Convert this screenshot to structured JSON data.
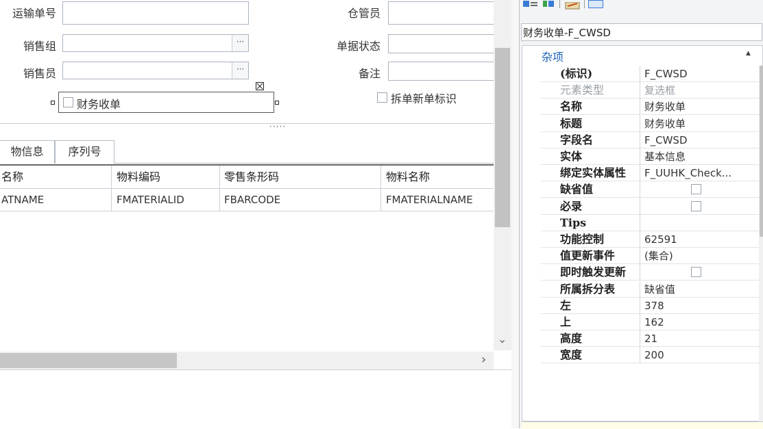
{
  "form": {
    "fields_left": [
      {
        "label": "运输单号",
        "has_ellipsis": false
      },
      {
        "label": "销售组",
        "has_ellipsis": true
      },
      {
        "label": "销售员",
        "has_ellipsis": true
      }
    ],
    "fields_right": [
      {
        "label": "仓管员"
      },
      {
        "label": "单据状态"
      },
      {
        "label": "备注"
      }
    ],
    "ellipsis_glyph": "···",
    "selected_checkbox_label": "财务收单",
    "split_checkbox_label": "拆单新单标识",
    "splitter_dots": "·····"
  },
  "tabs": [
    {
      "label": "物信息"
    },
    {
      "label": "序列号"
    }
  ],
  "grid": {
    "headers": [
      "名称",
      "物料编码",
      "零售条形码",
      "物料名称"
    ],
    "row": [
      "ATNAME",
      "FMATERIALID",
      "FBARCODE",
      "FMATERIALNAME"
    ]
  },
  "scroll": {
    "down_arrow": "⌄",
    "right_arrow": "›"
  },
  "property_panel": {
    "object_selector": "财务收单-F_CWSD",
    "category": "杂项",
    "collapse_glyph": "▲",
    "rows": [
      {
        "name": "(标识)",
        "value": "F_CWSD",
        "type": "text"
      },
      {
        "name": "元素类型",
        "value": "复选框",
        "type": "text",
        "dim": true
      },
      {
        "name": "名称",
        "value": "财务收单",
        "type": "text"
      },
      {
        "name": "标题",
        "value": "财务收单",
        "type": "text"
      },
      {
        "name": "字段名",
        "value": "F_CWSD",
        "type": "text"
      },
      {
        "name": "实体",
        "value": "基本信息",
        "type": "text"
      },
      {
        "name": "绑定实体属性",
        "value": "F_UUHK_Check...",
        "type": "text"
      },
      {
        "name": "缺省值",
        "value": "",
        "type": "checkbox"
      },
      {
        "name": "必录",
        "value": "",
        "type": "checkbox"
      },
      {
        "name": "Tips",
        "value": "",
        "type": "text"
      },
      {
        "name": "功能控制",
        "value": "62591",
        "type": "text"
      },
      {
        "name": "值更新事件",
        "value": "(集合)",
        "type": "text"
      },
      {
        "name": "即时触发更新",
        "value": "",
        "type": "checkbox"
      },
      {
        "name": "所属拆分表",
        "value": "缺省值",
        "type": "text"
      },
      {
        "name": "左",
        "value": "378",
        "type": "text"
      },
      {
        "name": "上",
        "value": "162",
        "type": "text"
      },
      {
        "name": "高度",
        "value": "21",
        "type": "text"
      },
      {
        "name": "宽度",
        "value": "200",
        "type": "text"
      }
    ]
  },
  "colors": {
    "accent": "#1a5fb4",
    "toolbar_icon_blue": "#3a7bd5",
    "toolbar_icon_green": "#3aa34a",
    "panel_bg": "#f3f4f6",
    "description_bg": "#fffde8"
  }
}
